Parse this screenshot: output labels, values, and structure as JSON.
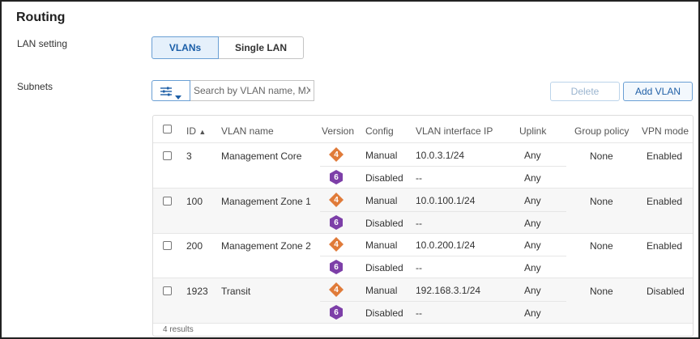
{
  "page": {
    "title": "Routing",
    "lan_setting_label": "LAN setting",
    "subnets_label": "Subnets"
  },
  "lan_mode": {
    "options": [
      "VLANs",
      "Single LAN"
    ],
    "selected": "VLANs"
  },
  "toolbar": {
    "search_placeholder": "Search by VLAN name, MX IP",
    "delete_label": "Delete",
    "add_label": "Add VLAN"
  },
  "colors": {
    "ipv4_badge": "#e07b39",
    "ipv6_badge": "#7d3fa8",
    "accent": "#1f5fa6"
  },
  "table": {
    "headers": {
      "id": "ID",
      "sort_indicator": "▲",
      "vlan_name": "VLAN name",
      "version": "Version",
      "config": "Config",
      "interface_ip": "VLAN interface IP",
      "uplink": "Uplink",
      "group_policy": "Group policy",
      "vpn_mode": "VPN mode"
    },
    "rows": [
      {
        "id": "3",
        "name": "Management Core",
        "v4": {
          "badge": "4",
          "config": "Manual",
          "ip": "10.0.3.1/24",
          "uplink": "Any"
        },
        "v6": {
          "badge": "6",
          "config": "Disabled",
          "ip": "--",
          "uplink": "Any"
        },
        "group_policy": "None",
        "vpn_mode": "Enabled"
      },
      {
        "id": "100",
        "name": "Management Zone 1",
        "v4": {
          "badge": "4",
          "config": "Manual",
          "ip": "10.0.100.1/24",
          "uplink": "Any"
        },
        "v6": {
          "badge": "6",
          "config": "Disabled",
          "ip": "--",
          "uplink": "Any"
        },
        "group_policy": "None",
        "vpn_mode": "Enabled"
      },
      {
        "id": "200",
        "name": "Management Zone 2",
        "v4": {
          "badge": "4",
          "config": "Manual",
          "ip": "10.0.200.1/24",
          "uplink": "Any"
        },
        "v6": {
          "badge": "6",
          "config": "Disabled",
          "ip": "--",
          "uplink": "Any"
        },
        "group_policy": "None",
        "vpn_mode": "Enabled"
      },
      {
        "id": "1923",
        "name": "Transit",
        "v4": {
          "badge": "4",
          "config": "Manual",
          "ip": "192.168.3.1/24",
          "uplink": "Any"
        },
        "v6": {
          "badge": "6",
          "config": "Disabled",
          "ip": "--",
          "uplink": "Any"
        },
        "group_policy": "None",
        "vpn_mode": "Disabled"
      }
    ],
    "footer": "4 results"
  },
  "icons": {
    "filter": "sliders-icon",
    "dropdown": "caret-down-icon",
    "ipv4": "ipv4-diamond-badge-icon",
    "ipv6": "ipv6-hexagon-badge-icon"
  }
}
